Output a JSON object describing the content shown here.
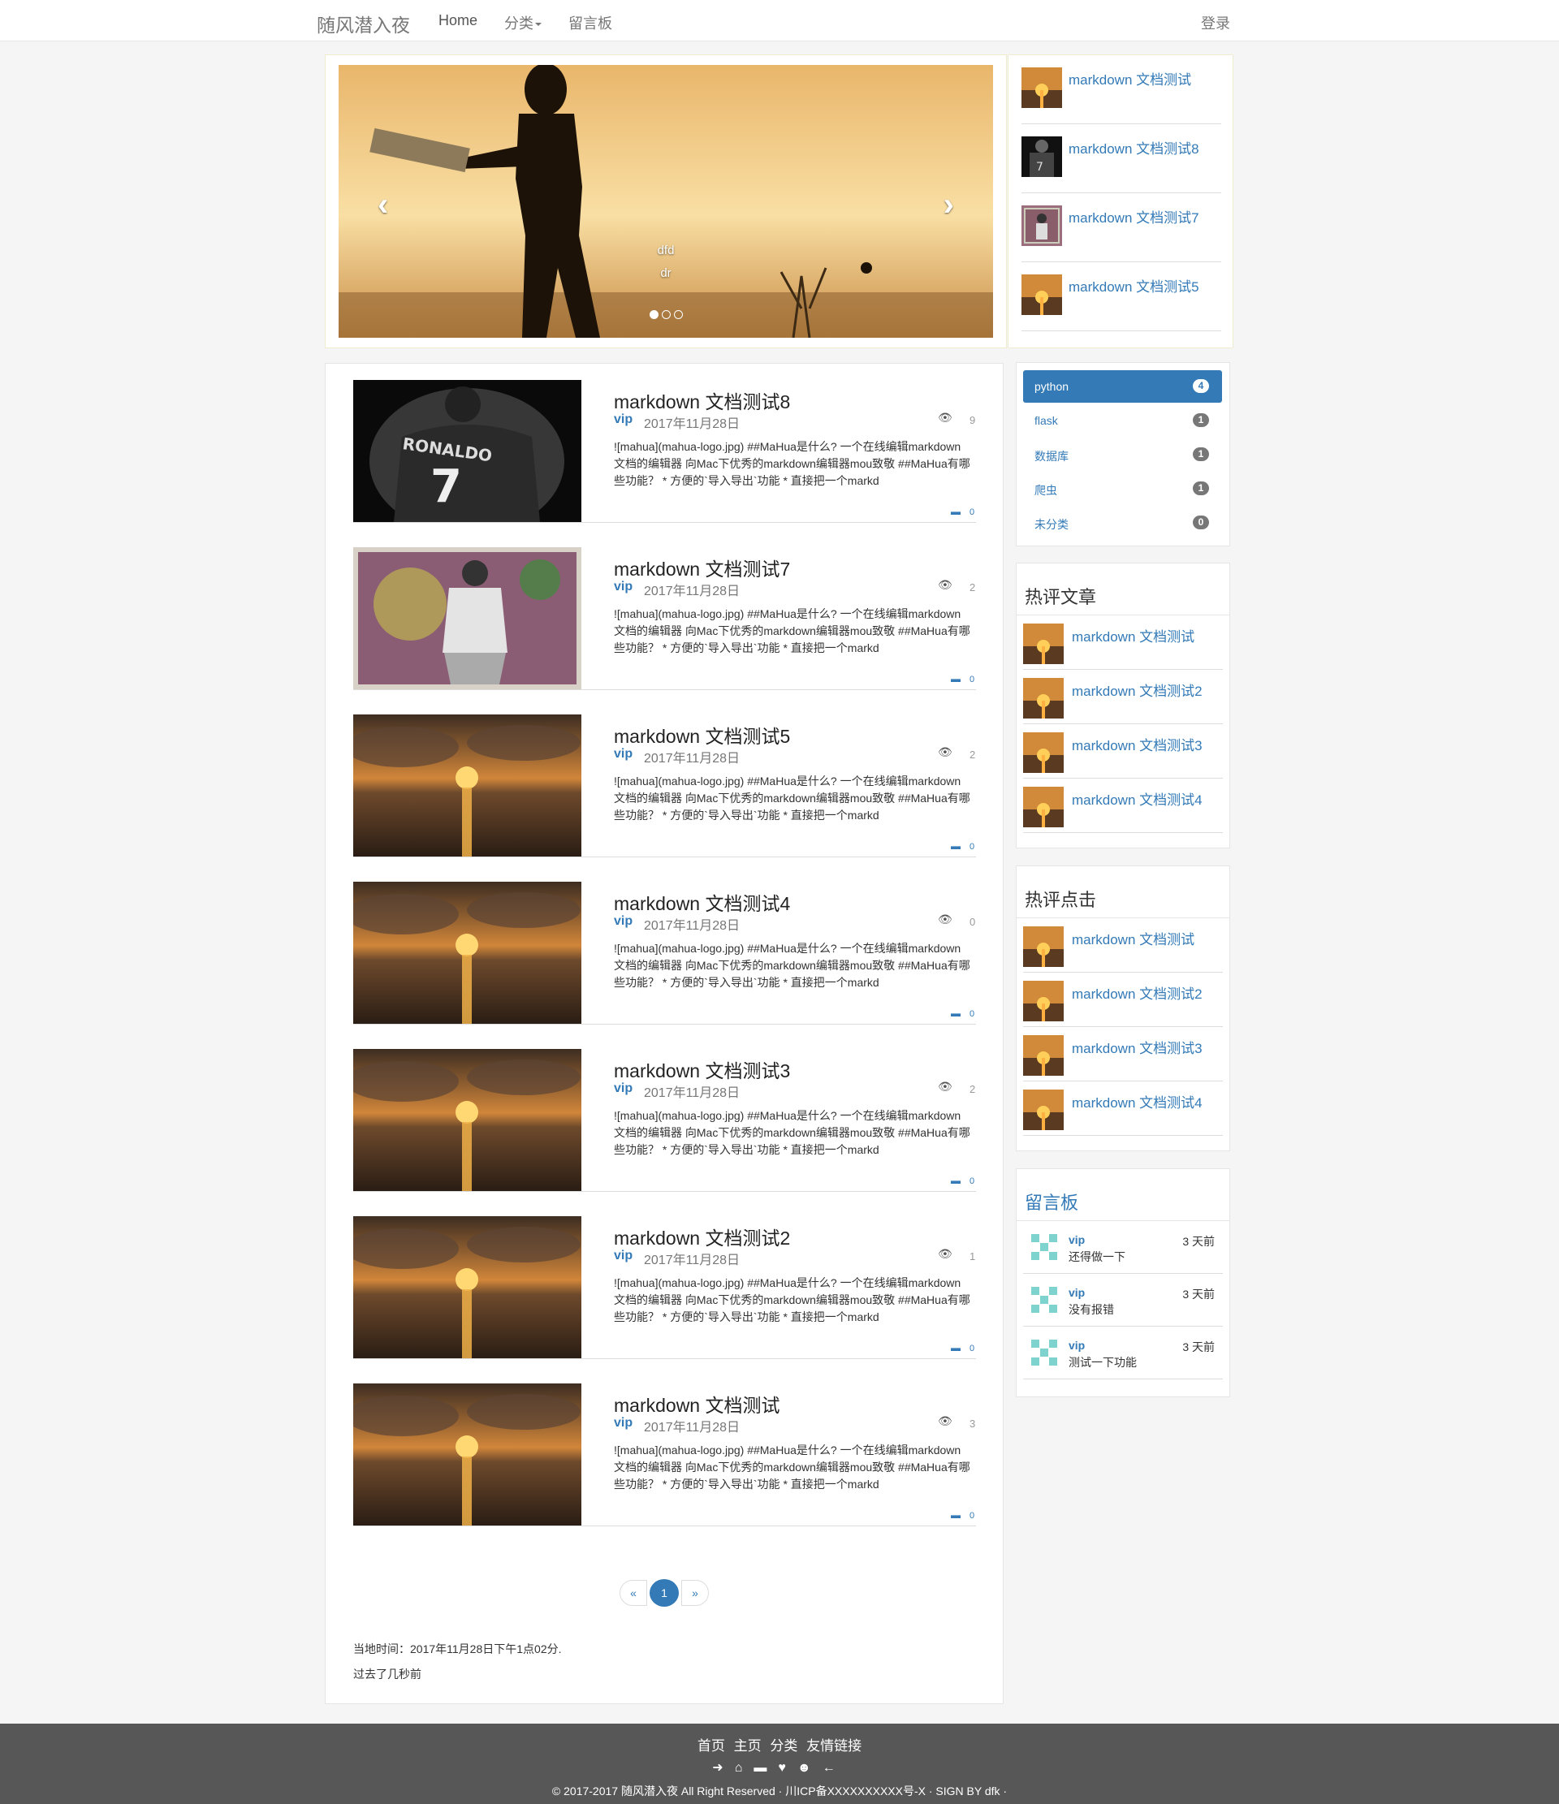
{
  "navbar": {
    "brand": "随风潜入夜",
    "home": "Home",
    "category": "分类",
    "guestbook": "留言板",
    "login": "登录"
  },
  "carousel": {
    "caption_line1": "dfd",
    "caption_line2": "dr",
    "prev": "‹",
    "next": "›",
    "slides": 3,
    "active_slide": 1
  },
  "side_top": {
    "items": [
      {
        "title": "markdown 文档测试"
      },
      {
        "title": "markdown 文档测试8"
      },
      {
        "title": "markdown 文档测试7"
      },
      {
        "title": "markdown 文档测试5"
      }
    ]
  },
  "articles": [
    {
      "title": "markdown 文档测试8",
      "author": "vip",
      "date": "2017年11月28日",
      "views": "9",
      "comments": "0",
      "summary": "![mahua](mahua-logo.jpg) ##MaHua是什么? 一个在线编辑markdown文档的编辑器 向Mac下优秀的markdown编辑器mou致敬 ##MaHua有哪些功能？ * 方便的`导入导出`功能 * 直接把一个markd"
    },
    {
      "title": "markdown 文档测试7",
      "author": "vip",
      "date": "2017年11月28日",
      "views": "2",
      "comments": "0",
      "summary": "![mahua](mahua-logo.jpg) ##MaHua是什么? 一个在线编辑markdown文档的编辑器 向Mac下优秀的markdown编辑器mou致敬 ##MaHua有哪些功能？ * 方便的`导入导出`功能 * 直接把一个markd"
    },
    {
      "title": "markdown 文档测试5",
      "author": "vip",
      "date": "2017年11月28日",
      "views": "2",
      "comments": "0",
      "summary": "![mahua](mahua-logo.jpg) ##MaHua是什么? 一个在线编辑markdown文档的编辑器 向Mac下优秀的markdown编辑器mou致敬 ##MaHua有哪些功能？ * 方便的`导入导出`功能 * 直接把一个markd"
    },
    {
      "title": "markdown 文档测试4",
      "author": "vip",
      "date": "2017年11月28日",
      "views": "0",
      "comments": "0",
      "summary": "![mahua](mahua-logo.jpg) ##MaHua是什么? 一个在线编辑markdown文档的编辑器 向Mac下优秀的markdown编辑器mou致敬 ##MaHua有哪些功能？ * 方便的`导入导出`功能 * 直接把一个markd"
    },
    {
      "title": "markdown 文档测试3",
      "author": "vip",
      "date": "2017年11月28日",
      "views": "2",
      "comments": "0",
      "summary": "![mahua](mahua-logo.jpg) ##MaHua是什么? 一个在线编辑markdown文档的编辑器 向Mac下优秀的markdown编辑器mou致敬 ##MaHua有哪些功能？ * 方便的`导入导出`功能 * 直接把一个markd"
    },
    {
      "title": "markdown 文档测试2",
      "author": "vip",
      "date": "2017年11月28日",
      "views": "1",
      "comments": "0",
      "summary": "![mahua](mahua-logo.jpg) ##MaHua是什么? 一个在线编辑markdown文档的编辑器 向Mac下优秀的markdown编辑器mou致敬 ##MaHua有哪些功能？ * 方便的`导入导出`功能 * 直接把一个markd"
    },
    {
      "title": "markdown 文档测试",
      "author": "vip",
      "date": "2017年11月28日",
      "views": "3",
      "comments": "0",
      "summary": "![mahua](mahua-logo.jpg) ##MaHua是什么? 一个在线编辑markdown文档的编辑器 向Mac下优秀的markdown编辑器mou致敬 ##MaHua有哪些功能？ * 方便的`导入导出`功能 * 直接把一个markd"
    }
  ],
  "pagination": {
    "prev": "«",
    "current": "1",
    "next": "»"
  },
  "local_time": "当地时间：2017年11月28日下午1点02分.",
  "time_ago": "过去了几秒前",
  "categories": [
    {
      "name": "python",
      "count": "4",
      "active": true
    },
    {
      "name": "flask",
      "count": "1"
    },
    {
      "name": "数据库",
      "count": "1"
    },
    {
      "name": "爬虫",
      "count": "1"
    },
    {
      "name": "未分类",
      "count": "0"
    }
  ],
  "hot_articles": {
    "title": "热评文章",
    "items": [
      {
        "title": "markdown 文档测试"
      },
      {
        "title": "markdown 文档测试2"
      },
      {
        "title": "markdown 文档测试3"
      },
      {
        "title": "markdown 文档测试4"
      }
    ]
  },
  "hot_clicks": {
    "title": "热评点击",
    "items": [
      {
        "title": "markdown 文档测试"
      },
      {
        "title": "markdown 文档测试2"
      },
      {
        "title": "markdown 文档测试3"
      },
      {
        "title": "markdown 文档测试4"
      }
    ]
  },
  "guestbook": {
    "title": "留言板",
    "items": [
      {
        "user": "vip",
        "text": "还得做一下",
        "time": "3 天前"
      },
      {
        "user": "vip",
        "text": "没有报错",
        "time": "3 天前"
      },
      {
        "user": "vip",
        "text": "测试一下功能",
        "time": "3 天前"
      }
    ]
  },
  "footer": {
    "links": [
      "首页",
      "主页",
      "分类",
      "友情链接"
    ],
    "icons": [
      "arrow-right-icon",
      "home-icon",
      "comment-icon",
      "heart-icon",
      "user-icon",
      "arrow-left-icon"
    ],
    "copyright": "© 2017-2017 随风潜入夜 All Right Reserved · 川ICP备XXXXXXXXXX号-X · SIGN BY dfk ·"
  },
  "colors": {
    "accent": "#337ab7",
    "footer_bg": "#575757"
  }
}
